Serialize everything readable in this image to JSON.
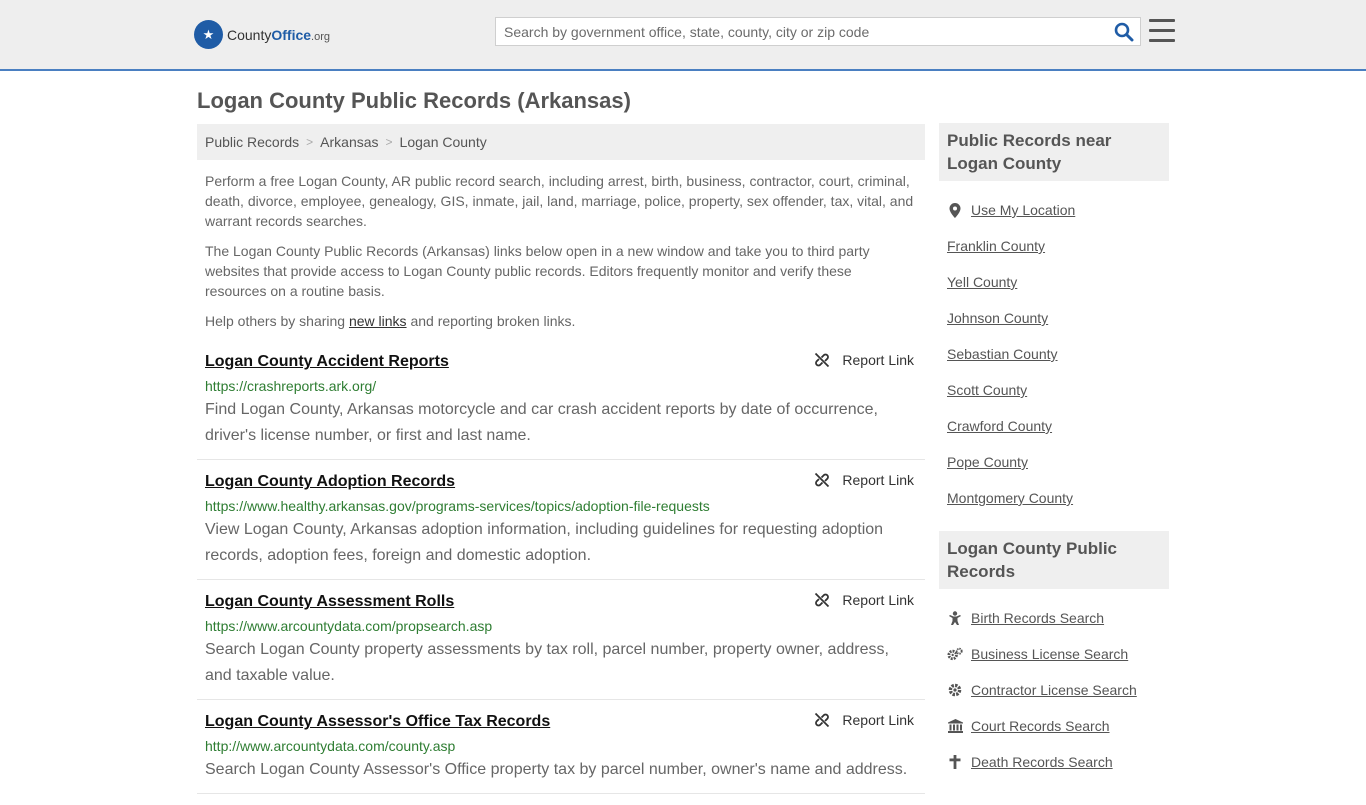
{
  "header": {
    "logo_text_a": "County",
    "logo_text_b": "Office",
    "logo_text_c": ".org",
    "search_placeholder": "Search by government office, state, county, city or zip code"
  },
  "page_title": "Logan County Public Records (Arkansas)",
  "breadcrumb": [
    "Public Records",
    "Arkansas",
    "Logan County"
  ],
  "intro": {
    "p1": "Perform a free Logan County, AR public record search, including arrest, birth, business, contractor, court, criminal, death, divorce, employee, genealogy, GIS, inmate, jail, land, marriage, police, property, sex offender, tax, vital, and warrant records searches.",
    "p2": "The Logan County Public Records (Arkansas) links below open in a new window and take you to third party websites that provide access to Logan County public records. Editors frequently monitor and verify these resources on a routine basis.",
    "p3_before": "Help others by sharing ",
    "p3_link": "new links",
    "p3_after": " and reporting broken links."
  },
  "report_label": "Report Link",
  "records": [
    {
      "title": "Logan County Accident Reports",
      "url": "https://crashreports.ark.org/",
      "desc": "Find Logan County, Arkansas motorcycle and car crash accident reports by date of occurrence, driver's license number, or first and last name."
    },
    {
      "title": "Logan County Adoption Records",
      "url": "https://www.healthy.arkansas.gov/programs-services/topics/adoption-file-requests",
      "desc": "View Logan County, Arkansas adoption information, including guidelines for requesting adoption records, adoption fees, foreign and domestic adoption."
    },
    {
      "title": "Logan County Assessment Rolls",
      "url": "https://www.arcountydata.com/propsearch.asp",
      "desc": "Search Logan County property assessments by tax roll, parcel number, property owner, address, and taxable value."
    },
    {
      "title": "Logan County Assessor's Office Tax Records",
      "url": "http://www.arcountydata.com/county.asp",
      "desc": "Search Logan County Assessor's Office property tax by parcel number, owner's name and address."
    }
  ],
  "sidebar": {
    "nearby_heading": "Public Records near Logan County",
    "nearby": [
      "Use My Location",
      "Franklin County",
      "Yell County",
      "Johnson County",
      "Sebastian County",
      "Scott County",
      "Crawford County",
      "Pope County",
      "Montgomery County"
    ],
    "records_heading": "Logan County Public Records",
    "record_links": [
      "Birth Records Search",
      "Business License Search",
      "Contractor License Search",
      "Court Records Search",
      "Death Records Search"
    ]
  }
}
